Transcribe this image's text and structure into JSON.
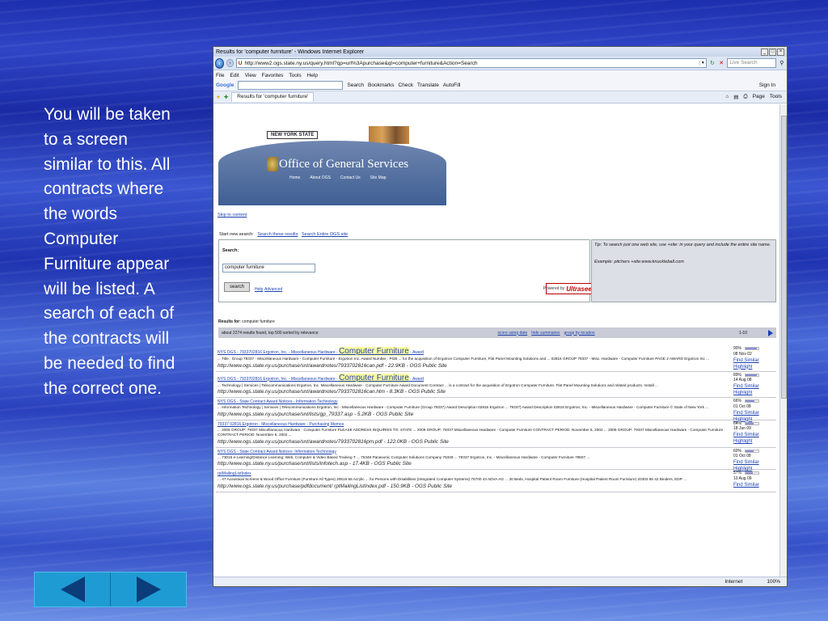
{
  "slide": {
    "text": "You will be taken to a screen similar to this. All contracts where the words Computer Furniture appear will be listed. A search of each of the contracts will be needed to find the correct one."
  },
  "browser": {
    "title": "Results for 'computer furniture' - Windows Internet Explorer",
    "address": "http://www2.ogs.state.ny.us/query.html?qp=url%3Apurchase&qt=computer+furniture&Action=Search",
    "live_search_placeholder": "Live Search",
    "menu": [
      "File",
      "Edit",
      "View",
      "Favorites",
      "Tools",
      "Help"
    ],
    "google_label": "Google",
    "google_toolbar": [
      "Search",
      "Bookmarks",
      "Check",
      "Translate",
      "AutoFill"
    ],
    "sign_in": "Sign In",
    "tab_label": "Results for 'computer furniture'",
    "tab_tools": [
      "Page",
      "Tools"
    ],
    "status_zone": "Internet",
    "zoom": "100%"
  },
  "ogs": {
    "state_label": "NEW YORK STATE",
    "title": "Office of General Services",
    "nav": [
      "Home",
      "About OGS",
      "Contact Us",
      "Site Map"
    ],
    "skip_link": "Skip to content"
  },
  "search": {
    "start_new": "Start new search:",
    "links": [
      "Search these results",
      "Search Entire OGS site"
    ],
    "label": "Search:",
    "query": "computer furniture",
    "button": "search",
    "help": "Help",
    "advanced": "Advanced",
    "powered_by": "Powered by",
    "powered_brand": "Ultraseek",
    "tip": "Tip: To search just one web site, use +site: in your query and include the entire site name.",
    "example": "Example: pitchers +site:www.knuckleball.com"
  },
  "results_header": {
    "results_for_label": "Results for:",
    "results_for_value": "computer furniture",
    "summary": "about 2274 results found, top 500 sorted by relevance",
    "links": [
      "score using date",
      "hide summaries",
      "group by location"
    ],
    "range": "1-10"
  },
  "results": [
    {
      "title_prefix": "NYS OGS - 7933702816 Ergotron, Inc. - Miscellaneous Hardware -",
      "title_highlight": "Computer Furniture",
      "title_suffix": "- Award",
      "snippet": "... Title : Group 79337 - Miscellaneous Hardware - Computer Furniture - Ergotron Inc. Award Number : PGB ... for the acquisition of Ergotron Computer Furniture, Flat Panel Mounting Solutions and ... 02816 GROUP 79337 - Misc. Hardware - Computer Furniture PAGE 2 AWARD Ergotron Inc ...",
      "url": "http://www.ogs.state.ny.us/purchase/snt/awardnotes/7933702816can.pdf - 22.9KB - OGS Public Site",
      "score": "90%",
      "score_value": 0.9,
      "date": "08 Nov 02",
      "find_similar": "Find Similar",
      "highlight": "Highlight"
    },
    {
      "title_prefix": "NYS OGS - 7933702816 Ergotron, Inc. - Miscellaneous Hardware -",
      "title_highlight": "Computer Furniture",
      "title_suffix": "- Award",
      "snippet": "... Technology | Services | Telecommunications Ergotron, Inc. Miscellaneous Hardware - Computer Furniture Award Document Contract ... is a contract for the acquisition of Ergotron Computer Furniture, Flat Panel Mounting Solutions and related products. Install ...",
      "url": "http://www.ogs.state.ny.us/purchase/snt/awardnotes/7933702816can.htm - 8.3KB - OGS Public Site",
      "score": "89%",
      "score_value": 0.89,
      "date": "14 Aug 08",
      "find_similar": "Find Similar",
      "highlight": "Highlight"
    },
    {
      "title_prefix": "NYS OGS - State Contract Award Notices - Information Technology",
      "title_highlight": "",
      "title_suffix": "",
      "snippet": "... Information Technology | Services | Telecommunications Ergotron, Inc - Miscellaneous Hardware - Computer Furniture (Group 79337) Award Description 02816 Ergotron ... 79337) Award Description 02816 Ergotron, Inc. - Miscellaneous Hardware - Computer Furniture © State of New York ...",
      "url": "http://www.ogs.state.ny.us/purchase/snt/lists/gp_79337.asp - 5.2KB - OGS Public Site",
      "score": "66%",
      "score_value": 0.66,
      "date": "01 Oct 08",
      "find_similar": "Find Similar",
      "highlight": "Highlight"
    },
    {
      "title_prefix": "79337 02816 Ergotron - Miscellaneous Hardware - Purchasing Memos",
      "title_highlight": "",
      "title_suffix": "",
      "snippet": "... 2009 GROUP: 79337 Miscellaneous Hardware - Computer Furniture PLEASE ADDRESS INQUIRIES TO: STATE ... 2009 GROUP: 79337 Miscellaneous Hardware - Computer Furniture CONTRACT PERIOD: November 6, 2002 ... 2009 GROUP: 79337 Miscellaneous Hardware - Computer Furniture CONTRACT PERIOD: November 6, 2002 ...",
      "url": "http://www.ogs.state.ny.us/purchase/snt/awardnotes/7933702816pm.pdf - 122.0KB - OGS Public Site",
      "score": "64%",
      "score_value": 0.64,
      "date": "18 Jun 09",
      "find_similar": "Find Similar",
      "highlight": "Highlight"
    },
    {
      "title_prefix": "NYS OGS - State Contract Award Notices: Information Technology",
      "title_highlight": "",
      "title_suffix": "",
      "snippet": "... 73016 e-Learning/Distance Learning: Web, Computer & Video Based Training T ... 75348 Panasonic Computer Solutions Company 75329 ... 79337 Ergotron, Inc. - Miscellaneous Hardware - Computer Furniture 79507 ...",
      "url": "http://www.ogs.state.ny.us/purchase/snt/lists/infotech.asp - 17.4KB - OGS Public Site",
      "score": "60%",
      "score_value": 0.6,
      "date": "01 Oct 08",
      "find_similar": "Find Similar",
      "highlight": "Highlight"
    },
    {
      "title_prefix": "rptMailingListIndex",
      "title_highlight": "",
      "title_suffix": "",
      "snippet": "... 47 Acoustical Screens & Wood Office Furniture (Furniture All Types) 20615 56 Acrylic ... for Persons with Disabilities (Integrated Computer Systems) 75700 43 ADVA AG ... 30 Beds, Hospital Patient Room Furniture (Hospital Patient Room Furniture) 20302 56 42 Binders, EDP ...",
      "url": "http://www.ogs.state.ny.us/purchase/pdfdocument/ rptMailingListIndex.pdf - 150.9KB - OGS Public Site",
      "score": "57%",
      "score_value": 0.57,
      "date": "10 Aug 09",
      "find_similar": "Find Similar",
      "highlight": ""
    }
  ],
  "nav_buttons": {
    "prev": "previous",
    "next": "next"
  }
}
